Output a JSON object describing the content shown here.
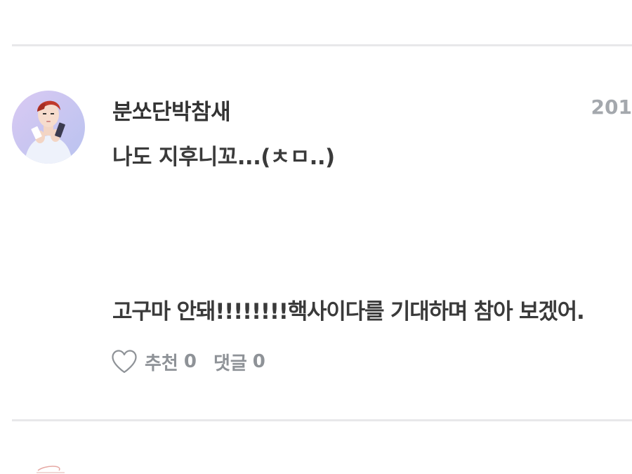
{
  "comment": {
    "author": "분쏘단박참새",
    "date": "201",
    "line1": "나도 지후니꼬...(ㅊㅁ..)",
    "line2": "고구마 안돼!!!!!!!!핵사이다를 기대하며 참아 보겠어.",
    "avatar_icon": "user-avatar-photo"
  },
  "actions": {
    "like_label": "추천",
    "like_count": "0",
    "reply_label": "댓글",
    "reply_count": "0",
    "like_icon": "heart-outline-icon"
  },
  "colors": {
    "text": "#333333",
    "muted": "#8e9297",
    "date": "#a4a8ad",
    "divider": "#e8e8ea"
  }
}
